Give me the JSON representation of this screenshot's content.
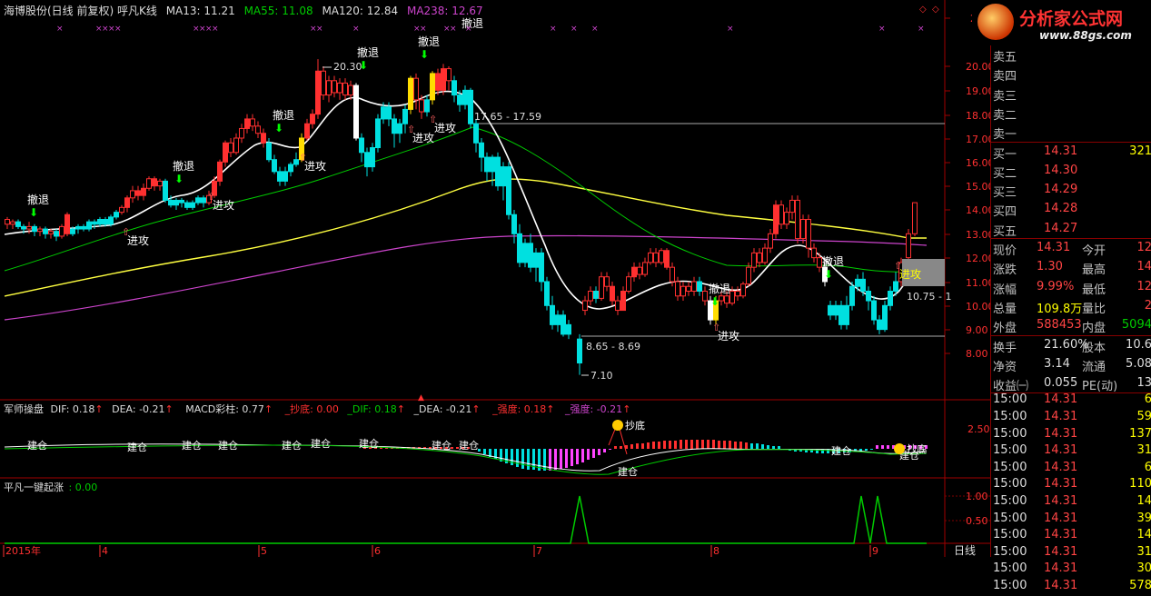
{
  "main_panel": {
    "title": "海博股份(日线 前复权) 呼凡K线",
    "ma13": "MA13: 11.21",
    "ma55": "MA55: 11.08",
    "ma120": "MA120: 12.84",
    "ma238": "MA238: 12.67",
    "price_axis": [
      "21",
      "20.00",
      "19.00",
      "18.00",
      "17.00",
      "16.00",
      "15.00",
      "14.00",
      "13.00",
      "12.00",
      "11.00",
      "10.00",
      "9.00",
      "8.00"
    ],
    "annotations": {
      "high_price": "20.30",
      "range_high": "17.65 - 17.59",
      "range_low": "8.65 - 8.69",
      "low_price": "7.10",
      "range_right": "10.75 - 1",
      "retreat": "撤退",
      "attack": "进攻"
    }
  },
  "macd_panel": {
    "title": "军师操盘",
    "dif": "DIF: 0.18",
    "dea": "DEA: -0.21",
    "macd_bar": "MACD彩柱: 0.77",
    "bottom": "_抄底: 0.00",
    "dif2": "_DIF: 0.18",
    "dea2": "_DEA: -0.21",
    "strong": "_强度: 0.18",
    "strength": "_强度: -0.21",
    "axis_top": "2.50",
    "build_label": "建仓",
    "bottom_label": "抄底"
  },
  "signal_panel": {
    "title": "平凡一键起涨",
    "value": ": 0.00",
    "axis": [
      "1.00",
      "0.50"
    ]
  },
  "time_axis": [
    "2015年",
    "4",
    "5",
    "6",
    "7",
    "8",
    "9"
  ],
  "timeframe_tab": "日线",
  "logo": {
    "text": "分析家公式网",
    "url_text": "www.88gs.com"
  },
  "quote": {
    "sell_labels": [
      "卖五",
      "卖四",
      "卖三",
      "卖二",
      "卖一"
    ],
    "buy_labels": [
      "买一",
      "买二",
      "买三",
      "买四",
      "买五"
    ],
    "buy_prices": [
      "14.31",
      "14.30",
      "14.29",
      "14.28",
      "14.27"
    ],
    "buy1_volume": "321",
    "stats": [
      {
        "l1": "现价",
        "v1": "14.31",
        "l2": "今开",
        "v2": "12"
      },
      {
        "l1": "涨跌",
        "v1": "1.30",
        "l2": "最高",
        "v2": "14"
      },
      {
        "l1": "涨幅",
        "v1": "9.99%",
        "l2": "最低",
        "v2": "12"
      },
      {
        "l1": "总量",
        "v1": "109.8万",
        "l2": "量比",
        "v2": "2"
      },
      {
        "l1": "外盘",
        "v1": "588453",
        "l2": "内盘",
        "v2": "5094"
      }
    ],
    "stats2": [
      {
        "l1": "换手",
        "v1": "21.60%",
        "l2": "股本",
        "v2": "10.6"
      },
      {
        "l1": "净资",
        "v1": "3.14",
        "l2": "流通",
        "v2": "5.08"
      },
      {
        "l1": "收益㈠",
        "v1": "0.055",
        "l2": "PE(动)",
        "v2": "13"
      }
    ],
    "ticks": [
      {
        "t": "15:00",
        "p": "14.31",
        "v": "6"
      },
      {
        "t": "15:00",
        "p": "14.31",
        "v": "59"
      },
      {
        "t": "15:00",
        "p": "14.31",
        "v": "137"
      },
      {
        "t": "15:00",
        "p": "14.31",
        "v": "31"
      },
      {
        "t": "15:00",
        "p": "14.31",
        "v": "6"
      },
      {
        "t": "15:00",
        "p": "14.31",
        "v": "110"
      },
      {
        "t": "15:00",
        "p": "14.31",
        "v": "14"
      },
      {
        "t": "15:00",
        "p": "14.31",
        "v": "39"
      },
      {
        "t": "15:00",
        "p": "14.31",
        "v": "14"
      },
      {
        "t": "15:00",
        "p": "14.31",
        "v": "31"
      },
      {
        "t": "15:00",
        "p": "14.31",
        "v": "30"
      },
      {
        "t": "15:00",
        "p": "14.31",
        "v": "578"
      }
    ]
  },
  "colors": {
    "up": "#ff3030",
    "down": "#00e0e0",
    "ma13": "#ffffff",
    "ma55": "#00cc00",
    "ma120": "#ffff40",
    "ma238": "#cc44cc",
    "grid": "#800000"
  }
}
